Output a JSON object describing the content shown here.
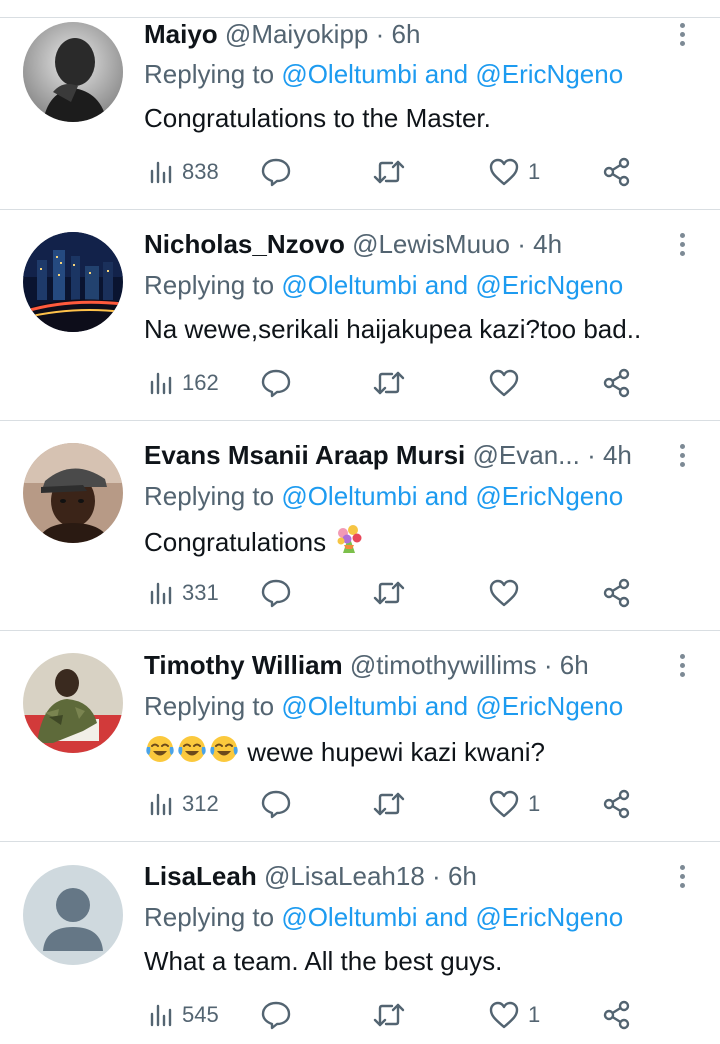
{
  "replies": [
    {
      "name": "Maiyo",
      "handle": "@Maiyokipp",
      "time": "6h",
      "reply_prefix": "Replying to",
      "mention_1": "@Oleltumbi",
      "mention_sep": "and",
      "mention_2": "@EricNgeno",
      "text": "Congratulations to the Master.",
      "views": "838",
      "likes": "1",
      "avatar": "portrait-grayscale"
    },
    {
      "name": "Nicholas_Nzovo",
      "handle": "@LewisMuuo",
      "time": "4h",
      "reply_prefix": "Replying to",
      "mention_1": "@Oleltumbi",
      "mention_sep": "and",
      "mention_2": "@EricNgeno",
      "text": "Na wewe,serikali haijakupea kazi?too bad..",
      "views": "162",
      "likes": "",
      "avatar": "city-night"
    },
    {
      "name": "Evans Msanii Araap Mursi",
      "handle": "@Evan...",
      "time": "4h",
      "reply_prefix": "Replying to",
      "mention_1": "@Oleltumbi",
      "mention_sep": "and",
      "mention_2": "@EricNgeno",
      "text": "Congratulations",
      "text_emoji": "bouquet",
      "views": "331",
      "likes": "",
      "avatar": "man-with-cap"
    },
    {
      "name": "Timothy William",
      "handle": "@timothywillims",
      "time": "6h",
      "reply_prefix": "Replying to",
      "mention_1": "@Oleltumbi",
      "mention_sep": "and",
      "mention_2": "@EricNgeno",
      "text_emoji": "tears-of-joy x3",
      "text": "wewe hupewi kazi kwani?",
      "views": "312",
      "likes": "1",
      "avatar": "man-in-camouflage"
    },
    {
      "name": "LisaLeah",
      "handle": "@LisaLeah18",
      "time": "6h",
      "reply_prefix": "Replying to",
      "mention_1": "@Oleltumbi",
      "mention_sep": "and",
      "mention_2": "@EricNgeno",
      "text": "What a team. All the best guys.",
      "views": "545",
      "likes": "1",
      "avatar": "default-silhouette"
    }
  ],
  "separator_dot": "·",
  "icons": [
    "views-icon",
    "reply-icon",
    "retweet-icon",
    "like-icon",
    "share-icon",
    "more-icon"
  ],
  "colors": {
    "link": "#1d9bf0",
    "secondary": "#536471",
    "text": "#0f1419",
    "divider": "#d9dee2"
  }
}
